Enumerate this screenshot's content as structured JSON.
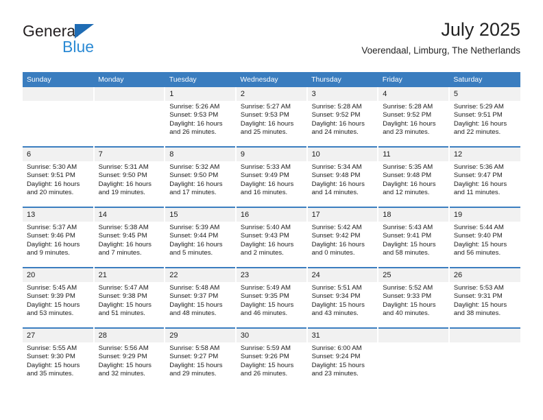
{
  "brand": {
    "name_top": "General",
    "name_bottom": "Blue",
    "triangle_color": "#1f6cb4",
    "blue_text_color": "#2b8ad4"
  },
  "header": {
    "title": "July 2025",
    "subtitle": "Voerendaal, Limburg, The Netherlands"
  },
  "theme": {
    "header_blue": "#3a7dbf",
    "daynum_band": "#f1f1f1",
    "text": "#1a1a1a"
  },
  "weekdays": [
    "Sunday",
    "Monday",
    "Tuesday",
    "Wednesday",
    "Thursday",
    "Friday",
    "Saturday"
  ],
  "labels": {
    "sunrise_prefix": "Sunrise:",
    "sunset_prefix": "Sunset:",
    "daylight_prefix": "Daylight:"
  },
  "weeks": [
    [
      {
        "day": "",
        "empty": true
      },
      {
        "day": "",
        "empty": true
      },
      {
        "day": "1",
        "sunrise": "Sunrise: 5:26 AM",
        "sunset": "Sunset: 9:53 PM",
        "daylight_l1": "Daylight: 16 hours",
        "daylight_l2": "and 26 minutes."
      },
      {
        "day": "2",
        "sunrise": "Sunrise: 5:27 AM",
        "sunset": "Sunset: 9:53 PM",
        "daylight_l1": "Daylight: 16 hours",
        "daylight_l2": "and 25 minutes."
      },
      {
        "day": "3",
        "sunrise": "Sunrise: 5:28 AM",
        "sunset": "Sunset: 9:52 PM",
        "daylight_l1": "Daylight: 16 hours",
        "daylight_l2": "and 24 minutes."
      },
      {
        "day": "4",
        "sunrise": "Sunrise: 5:28 AM",
        "sunset": "Sunset: 9:52 PM",
        "daylight_l1": "Daylight: 16 hours",
        "daylight_l2": "and 23 minutes."
      },
      {
        "day": "5",
        "sunrise": "Sunrise: 5:29 AM",
        "sunset": "Sunset: 9:51 PM",
        "daylight_l1": "Daylight: 16 hours",
        "daylight_l2": "and 22 minutes."
      }
    ],
    [
      {
        "day": "6",
        "sunrise": "Sunrise: 5:30 AM",
        "sunset": "Sunset: 9:51 PM",
        "daylight_l1": "Daylight: 16 hours",
        "daylight_l2": "and 20 minutes."
      },
      {
        "day": "7",
        "sunrise": "Sunrise: 5:31 AM",
        "sunset": "Sunset: 9:50 PM",
        "daylight_l1": "Daylight: 16 hours",
        "daylight_l2": "and 19 minutes."
      },
      {
        "day": "8",
        "sunrise": "Sunrise: 5:32 AM",
        "sunset": "Sunset: 9:50 PM",
        "daylight_l1": "Daylight: 16 hours",
        "daylight_l2": "and 17 minutes."
      },
      {
        "day": "9",
        "sunrise": "Sunrise: 5:33 AM",
        "sunset": "Sunset: 9:49 PM",
        "daylight_l1": "Daylight: 16 hours",
        "daylight_l2": "and 16 minutes."
      },
      {
        "day": "10",
        "sunrise": "Sunrise: 5:34 AM",
        "sunset": "Sunset: 9:48 PM",
        "daylight_l1": "Daylight: 16 hours",
        "daylight_l2": "and 14 minutes."
      },
      {
        "day": "11",
        "sunrise": "Sunrise: 5:35 AM",
        "sunset": "Sunset: 9:48 PM",
        "daylight_l1": "Daylight: 16 hours",
        "daylight_l2": "and 12 minutes."
      },
      {
        "day": "12",
        "sunrise": "Sunrise: 5:36 AM",
        "sunset": "Sunset: 9:47 PM",
        "daylight_l1": "Daylight: 16 hours",
        "daylight_l2": "and 11 minutes."
      }
    ],
    [
      {
        "day": "13",
        "sunrise": "Sunrise: 5:37 AM",
        "sunset": "Sunset: 9:46 PM",
        "daylight_l1": "Daylight: 16 hours",
        "daylight_l2": "and 9 minutes."
      },
      {
        "day": "14",
        "sunrise": "Sunrise: 5:38 AM",
        "sunset": "Sunset: 9:45 PM",
        "daylight_l1": "Daylight: 16 hours",
        "daylight_l2": "and 7 minutes."
      },
      {
        "day": "15",
        "sunrise": "Sunrise: 5:39 AM",
        "sunset": "Sunset: 9:44 PM",
        "daylight_l1": "Daylight: 16 hours",
        "daylight_l2": "and 5 minutes."
      },
      {
        "day": "16",
        "sunrise": "Sunrise: 5:40 AM",
        "sunset": "Sunset: 9:43 PM",
        "daylight_l1": "Daylight: 16 hours",
        "daylight_l2": "and 2 minutes."
      },
      {
        "day": "17",
        "sunrise": "Sunrise: 5:42 AM",
        "sunset": "Sunset: 9:42 PM",
        "daylight_l1": "Daylight: 16 hours",
        "daylight_l2": "and 0 minutes."
      },
      {
        "day": "18",
        "sunrise": "Sunrise: 5:43 AM",
        "sunset": "Sunset: 9:41 PM",
        "daylight_l1": "Daylight: 15 hours",
        "daylight_l2": "and 58 minutes."
      },
      {
        "day": "19",
        "sunrise": "Sunrise: 5:44 AM",
        "sunset": "Sunset: 9:40 PM",
        "daylight_l1": "Daylight: 15 hours",
        "daylight_l2": "and 56 minutes."
      }
    ],
    [
      {
        "day": "20",
        "sunrise": "Sunrise: 5:45 AM",
        "sunset": "Sunset: 9:39 PM",
        "daylight_l1": "Daylight: 15 hours",
        "daylight_l2": "and 53 minutes."
      },
      {
        "day": "21",
        "sunrise": "Sunrise: 5:47 AM",
        "sunset": "Sunset: 9:38 PM",
        "daylight_l1": "Daylight: 15 hours",
        "daylight_l2": "and 51 minutes."
      },
      {
        "day": "22",
        "sunrise": "Sunrise: 5:48 AM",
        "sunset": "Sunset: 9:37 PM",
        "daylight_l1": "Daylight: 15 hours",
        "daylight_l2": "and 48 minutes."
      },
      {
        "day": "23",
        "sunrise": "Sunrise: 5:49 AM",
        "sunset": "Sunset: 9:35 PM",
        "daylight_l1": "Daylight: 15 hours",
        "daylight_l2": "and 46 minutes."
      },
      {
        "day": "24",
        "sunrise": "Sunrise: 5:51 AM",
        "sunset": "Sunset: 9:34 PM",
        "daylight_l1": "Daylight: 15 hours",
        "daylight_l2": "and 43 minutes."
      },
      {
        "day": "25",
        "sunrise": "Sunrise: 5:52 AM",
        "sunset": "Sunset: 9:33 PM",
        "daylight_l1": "Daylight: 15 hours",
        "daylight_l2": "and 40 minutes."
      },
      {
        "day": "26",
        "sunrise": "Sunrise: 5:53 AM",
        "sunset": "Sunset: 9:31 PM",
        "daylight_l1": "Daylight: 15 hours",
        "daylight_l2": "and 38 minutes."
      }
    ],
    [
      {
        "day": "27",
        "sunrise": "Sunrise: 5:55 AM",
        "sunset": "Sunset: 9:30 PM",
        "daylight_l1": "Daylight: 15 hours",
        "daylight_l2": "and 35 minutes."
      },
      {
        "day": "28",
        "sunrise": "Sunrise: 5:56 AM",
        "sunset": "Sunset: 9:29 PM",
        "daylight_l1": "Daylight: 15 hours",
        "daylight_l2": "and 32 minutes."
      },
      {
        "day": "29",
        "sunrise": "Sunrise: 5:58 AM",
        "sunset": "Sunset: 9:27 PM",
        "daylight_l1": "Daylight: 15 hours",
        "daylight_l2": "and 29 minutes."
      },
      {
        "day": "30",
        "sunrise": "Sunrise: 5:59 AM",
        "sunset": "Sunset: 9:26 PM",
        "daylight_l1": "Daylight: 15 hours",
        "daylight_l2": "and 26 minutes."
      },
      {
        "day": "31",
        "sunrise": "Sunrise: 6:00 AM",
        "sunset": "Sunset: 9:24 PM",
        "daylight_l1": "Daylight: 15 hours",
        "daylight_l2": "and 23 minutes."
      },
      {
        "day": "",
        "empty": true
      },
      {
        "day": "",
        "empty": true
      }
    ]
  ]
}
